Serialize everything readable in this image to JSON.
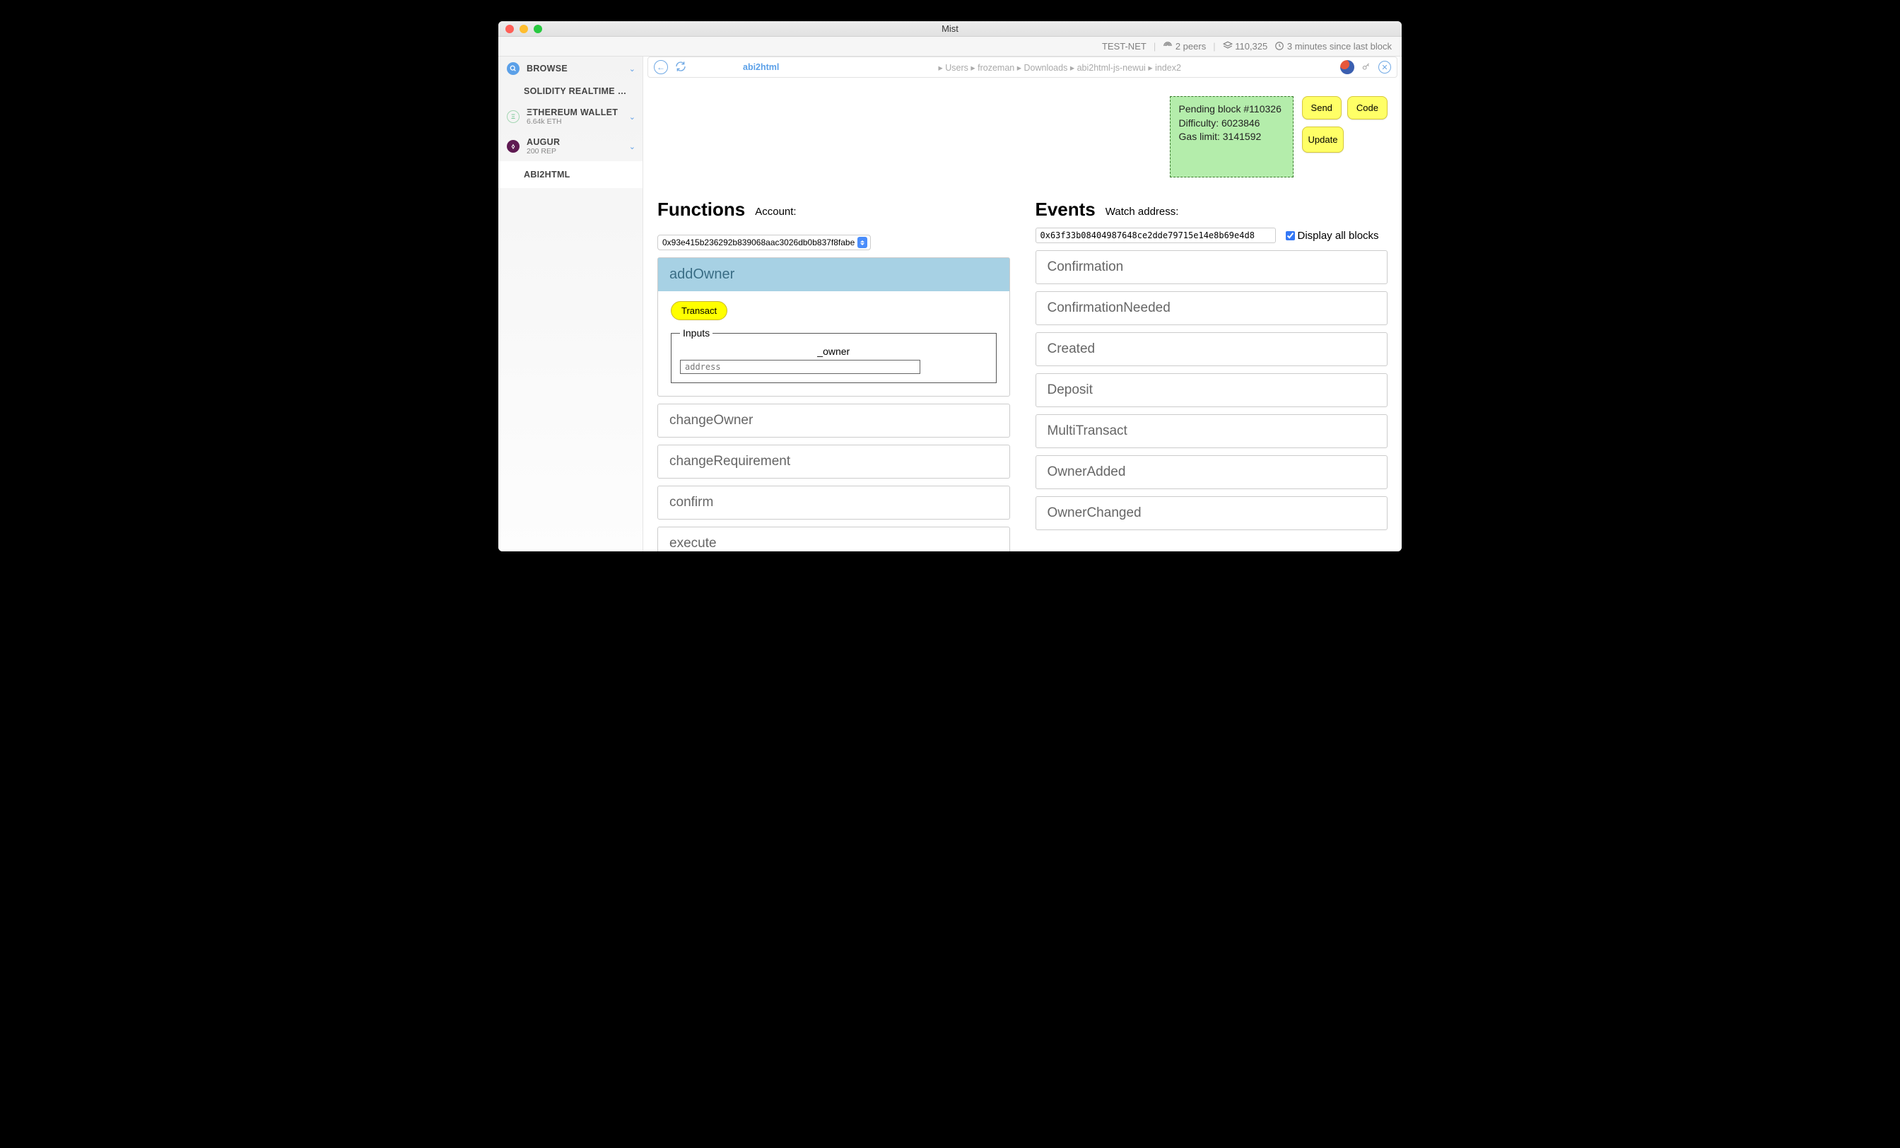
{
  "window": {
    "title": "Mist"
  },
  "status": {
    "net": "TEST-NET",
    "peers": "2 peers",
    "block_count": "110,325",
    "since": "3 minutes since last block"
  },
  "sidebar": {
    "browse": "BROWSE",
    "solidity": "SOLIDITY REALTIME …",
    "eth_wallet": "ΞTHEREUM WALLET",
    "eth_balance": "6.64k ETH",
    "augur": "AUGUR",
    "augur_balance": "200 REP",
    "abi2html": "ABI2HTML"
  },
  "urlbar": {
    "app": "abi2html",
    "path": [
      "Users",
      "frozeman",
      "Downloads",
      "abi2html-js-newui",
      "index2"
    ]
  },
  "pending": {
    "line1": "Pending block #110326",
    "line2": "Difficulty: 6023846",
    "line3": "Gas limit: 3141592"
  },
  "buttons": {
    "send": "Send",
    "code": "Code",
    "update": "Update"
  },
  "functions": {
    "title": "Functions",
    "account_label": "Account:",
    "account_value": "0x93e415b236292b839068aac3026db0b837f8fabe",
    "transact": "Transact",
    "inputs_legend": "Inputs",
    "input_name": "_owner",
    "input_placeholder": "address",
    "items": [
      "addOwner",
      "changeOwner",
      "changeRequirement",
      "confirm",
      "execute"
    ]
  },
  "events": {
    "title": "Events",
    "watch_label": "Watch address:",
    "watch_value": "0x63f33b08404987648ce2dde79715e14e8b69e4d8",
    "display_all": "Display all blocks",
    "items": [
      "Confirmation",
      "ConfirmationNeeded",
      "Created",
      "Deposit",
      "MultiTransact",
      "OwnerAdded",
      "OwnerChanged"
    ]
  }
}
